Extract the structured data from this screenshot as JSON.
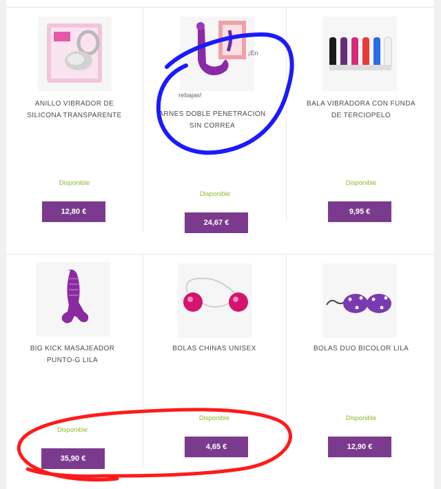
{
  "products": [
    {
      "title_line1": "ANILLO VIBRADOR DE",
      "title_line2": "SILICONA TRANSPARENTE",
      "availability": "Disponible",
      "price": "12,80 €",
      "image_icon": "ring-vibrator-package-icon"
    },
    {
      "promo_line1": "¡En",
      "promo_line2": "rebajas!",
      "title_line1": "ARNES DOBLE PENETRACION",
      "title_line2": "SIN CORREA",
      "availability": "Disponible",
      "price": "24,67 €",
      "image_icon": "strapless-harness-icon"
    },
    {
      "title_line1": "BALA VIBRADORA CON FUNDA",
      "title_line2": "DE TERCIOPELO",
      "availability": "Disponible",
      "price": "9,95 €",
      "image_icon": "bullet-vibrators-icon"
    },
    {
      "title_line1": "BIG KICK MASAJEADOR",
      "title_line2": "PUNTO-G LILA",
      "availability": "Disponible",
      "price": "35,90 €",
      "image_icon": "g-spot-massager-icon"
    },
    {
      "title_line1": "BOLAS CHINAS UNISEX",
      "title_line2": "",
      "availability": "Disponible",
      "price": "4,65 €",
      "image_icon": "chinese-balls-icon"
    },
    {
      "title_line1": "BOLAS DUO BICOLOR LILA",
      "title_line2": "",
      "availability": "Disponible",
      "price": "12,90 €",
      "image_icon": "duo-balls-icon"
    }
  ],
  "colors": {
    "price_button": "#7a3a8e",
    "availability": "#8bb92a",
    "annotation_blue": "#1a1aff",
    "annotation_red": "#ff1a1a"
  }
}
